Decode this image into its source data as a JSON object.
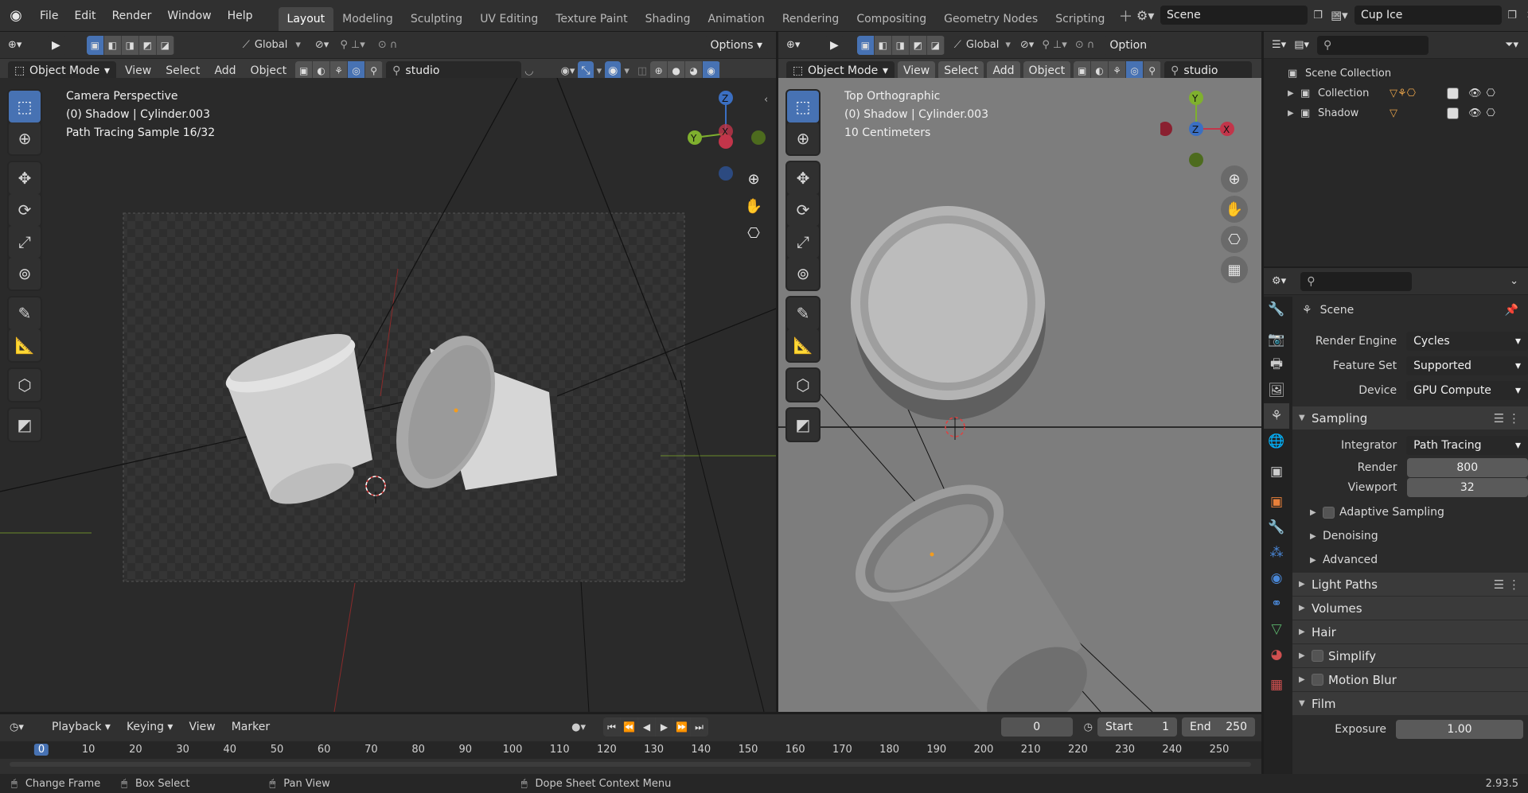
{
  "menu": {
    "file": "File",
    "edit": "Edit",
    "render": "Render",
    "window": "Window",
    "help": "Help"
  },
  "workspaces": [
    "Layout",
    "Modeling",
    "Sculpting",
    "UV Editing",
    "Texture Paint",
    "Shading",
    "Animation",
    "Rendering",
    "Compositing",
    "Geometry Nodes",
    "Scripting"
  ],
  "scene_name": "Scene",
  "view_layer": "Cup Ice",
  "left_view": {
    "orientation": "Global",
    "options": "Options",
    "mode": "Object Mode",
    "view": "View",
    "select": "Select",
    "add": "Add",
    "object": "Object",
    "world": "studio",
    "overlay": [
      "Camera Perspective",
      "(0) Shadow | Cylinder.003",
      "Path Tracing Sample 16/32"
    ]
  },
  "right_view": {
    "orientation": "Global",
    "options": "Option",
    "mode": "Object Mode",
    "view": "View",
    "select": "Select",
    "add": "Add",
    "object": "Object",
    "world": "studio",
    "overlay": [
      "Top Orthographic",
      "(0) Shadow | Cylinder.003",
      "10 Centimeters"
    ]
  },
  "outliner": {
    "root": "Scene Collection",
    "items": [
      {
        "label": "Collection",
        "badges": "4 3"
      },
      {
        "label": "Shadow"
      }
    ]
  },
  "properties": {
    "context": "Scene",
    "render_engine_label": "Render Engine",
    "render_engine": "Cycles",
    "feature_set_label": "Feature Set",
    "feature_set": "Supported",
    "device_label": "Device",
    "device": "GPU Compute",
    "sampling": "Sampling",
    "integrator_label": "Integrator",
    "integrator": "Path Tracing",
    "render_label": "Render",
    "render_samples": "800",
    "viewport_label": "Viewport",
    "viewport_samples": "32",
    "adaptive": "Adaptive Sampling",
    "denoising": "Denoising",
    "advanced": "Advanced",
    "light_paths": "Light Paths",
    "volumes": "Volumes",
    "hair": "Hair",
    "simplify": "Simplify",
    "motion_blur": "Motion Blur",
    "film": "Film",
    "exposure_label": "Exposure",
    "exposure": "1.00"
  },
  "timeline": {
    "playback": "Playback",
    "keying": "Keying",
    "view": "View",
    "marker": "Marker",
    "current_frame": "0",
    "start_label": "Start",
    "start": "1",
    "end_label": "End",
    "end": "250",
    "ticks": [
      "0",
      "10",
      "20",
      "30",
      "40",
      "50",
      "60",
      "70",
      "80",
      "90",
      "100",
      "110",
      "120",
      "130",
      "140",
      "150",
      "160",
      "170",
      "180",
      "190",
      "200",
      "210",
      "220",
      "230",
      "240",
      "250"
    ]
  },
  "status": {
    "change_frame": "Change Frame",
    "box_select": "Box Select",
    "pan_view": "Pan View",
    "context_menu": "Dope Sheet Context Menu",
    "version": "2.93.5"
  }
}
